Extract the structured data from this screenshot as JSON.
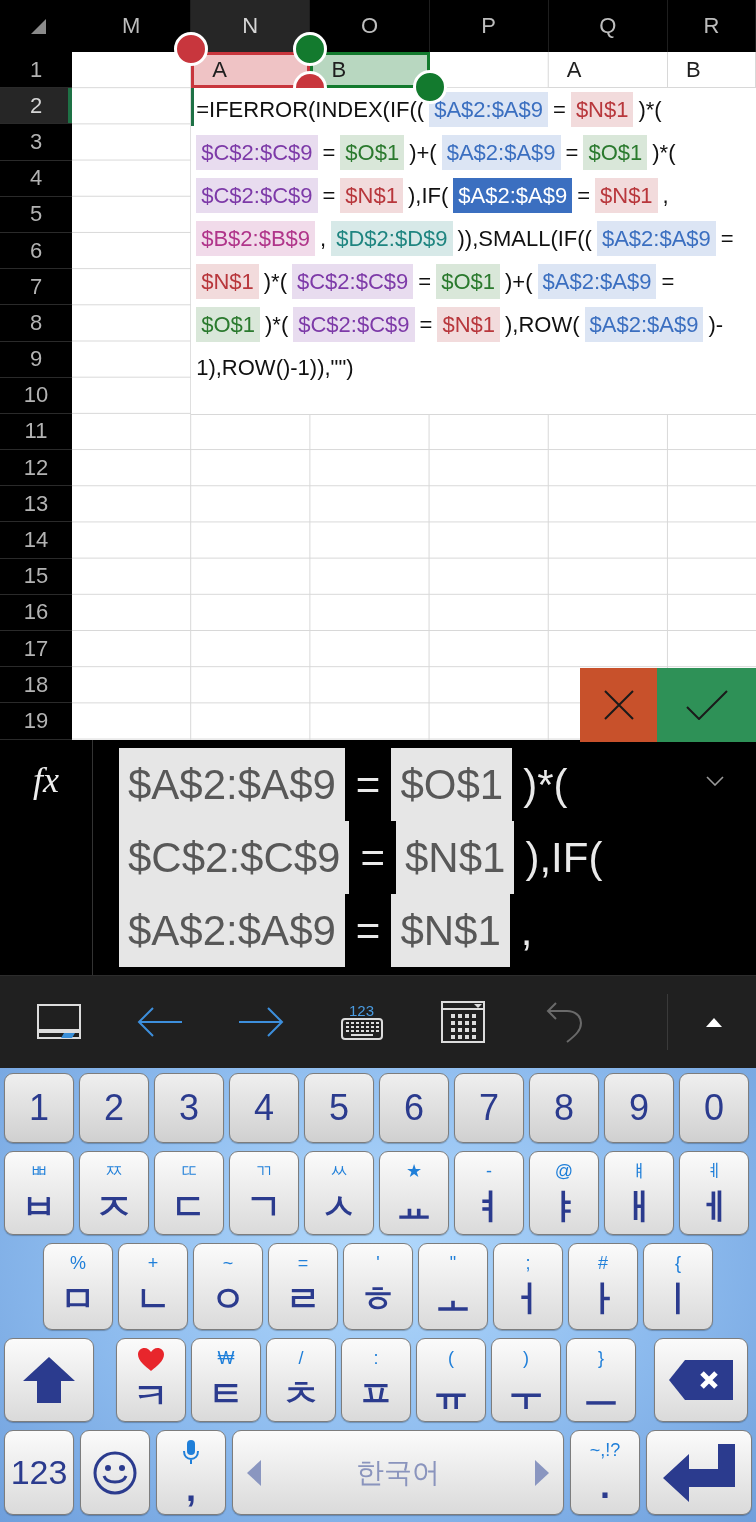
{
  "grid": {
    "columns": [
      {
        "label": "M",
        "selected": false
      },
      {
        "label": "N",
        "selected": true
      },
      {
        "label": "O",
        "selected": false
      },
      {
        "label": "P",
        "selected": false
      },
      {
        "label": "Q",
        "selected": false
      },
      {
        "label": "R",
        "selected": false
      }
    ],
    "rows": [
      {
        "label": "1",
        "selected": false,
        "cells": [
          null,
          {
            "text": "A",
            "color": "#c8363d"
          },
          {
            "text": "B",
            "color": "#137a2e"
          },
          null,
          {
            "text": "A"
          },
          {
            "text": "B"
          }
        ]
      },
      {
        "label": "2",
        "selected": true
      },
      {
        "label": "3",
        "selected": false
      },
      {
        "label": "4",
        "selected": false
      },
      {
        "label": "5",
        "selected": false
      },
      {
        "label": "6",
        "selected": false
      },
      {
        "label": "7",
        "selected": false
      },
      {
        "label": "8",
        "selected": false
      },
      {
        "label": "9",
        "selected": false
      },
      {
        "label": "10",
        "selected": false
      },
      {
        "label": "11",
        "selected": false
      },
      {
        "label": "12",
        "selected": false
      },
      {
        "label": "13",
        "selected": false
      },
      {
        "label": "14",
        "selected": false
      },
      {
        "label": "15",
        "selected": false
      },
      {
        "label": "16",
        "selected": false
      },
      {
        "label": "17",
        "selected": false
      },
      {
        "label": "18",
        "selected": false
      },
      {
        "label": "19",
        "selected": false
      }
    ]
  },
  "cell_editor": {
    "lines": [
      [
        {
          "kind": "text",
          "text": "=IFERROR(INDEX(IF(("
        },
        {
          "kind": "ref",
          "text": "$A$2:$A$9",
          "color": "#3b6fc0",
          "selected": false
        },
        {
          "kind": "text",
          "text": "="
        },
        {
          "kind": "ref",
          "text": "$N$1",
          "color": "#b8373c",
          "selected": false
        },
        {
          "kind": "text",
          "text": ")*("
        }
      ],
      [
        {
          "kind": "ref",
          "text": "$C$2:$C$9",
          "color": "#7d3aa8",
          "selected": false
        },
        {
          "kind": "text",
          "text": "="
        },
        {
          "kind": "ref",
          "text": "$O$1",
          "color": "#2b7a2e",
          "selected": false
        },
        {
          "kind": "text",
          "text": ")+("
        },
        {
          "kind": "ref",
          "text": "$A$2:$A$9",
          "color": "#3b6fc0",
          "selected": false
        },
        {
          "kind": "text",
          "text": "="
        },
        {
          "kind": "ref",
          "text": "$O$1",
          "color": "#2b7a2e",
          "selected": false
        },
        {
          "kind": "text",
          "text": ")*("
        }
      ],
      [
        {
          "kind": "ref",
          "text": "$C$2:$C$9",
          "color": "#7d3aa8",
          "selected": false
        },
        {
          "kind": "text",
          "text": "="
        },
        {
          "kind": "ref",
          "text": "$N$1",
          "color": "#b8373c",
          "selected": false
        },
        {
          "kind": "text",
          "text": "),IF("
        },
        {
          "kind": "ref",
          "text": "$A$2:$A$9",
          "color": "#3b6fc0",
          "selected": true
        },
        {
          "kind": "text",
          "text": "="
        },
        {
          "kind": "ref",
          "text": "$N$1",
          "color": "#b8373c",
          "selected": false
        },
        {
          "kind": "text",
          "text": ","
        }
      ],
      [
        {
          "kind": "ref",
          "text": "$B$2:$B$9",
          "color": "#b0358a",
          "selected": false
        },
        {
          "kind": "text",
          "text": ","
        },
        {
          "kind": "ref",
          "text": "$D$2:$D$9",
          "color": "#1f8580",
          "selected": false
        },
        {
          "kind": "text",
          "text": ")),SMALL(IF(("
        },
        {
          "kind": "ref",
          "text": "$A$2:$A$9",
          "color": "#3b6fc0",
          "selected": false
        },
        {
          "kind": "text",
          "text": "="
        }
      ],
      [
        {
          "kind": "ref",
          "text": "$N$1",
          "color": "#b8373c",
          "selected": false
        },
        {
          "kind": "text",
          "text": ")*("
        },
        {
          "kind": "ref",
          "text": "$C$2:$C$9",
          "color": "#7d3aa8",
          "selected": false
        },
        {
          "kind": "text",
          "text": "="
        },
        {
          "kind": "ref",
          "text": "$O$1",
          "color": "#2b7a2e",
          "selected": false
        },
        {
          "kind": "text",
          "text": ")+("
        },
        {
          "kind": "ref",
          "text": "$A$2:$A$9",
          "color": "#3b6fc0",
          "selected": false
        },
        {
          "kind": "text",
          "text": "="
        }
      ],
      [
        {
          "kind": "ref",
          "text": "$O$1",
          "color": "#2b7a2e",
          "selected": false
        },
        {
          "kind": "text",
          "text": ")*("
        },
        {
          "kind": "ref",
          "text": "$C$2:$C$9",
          "color": "#7d3aa8",
          "selected": false
        },
        {
          "kind": "text",
          "text": "="
        },
        {
          "kind": "ref",
          "text": "$N$1",
          "color": "#b8373c",
          "selected": false
        },
        {
          "kind": "text",
          "text": "),ROW("
        },
        {
          "kind": "ref",
          "text": "$A$2:$A$9",
          "color": "#3b6fc0",
          "selected": false
        },
        {
          "kind": "text",
          "text": ")-"
        }
      ],
      [
        {
          "kind": "text",
          "text": "1),ROW()-1)),\"\")"
        }
      ]
    ]
  },
  "formula_bar": {
    "label": "fx",
    "lines": [
      [
        {
          "kind": "ref",
          "text": "$A$2:$A$9"
        },
        {
          "kind": "text",
          "text": "="
        },
        {
          "kind": "ref",
          "text": "$O$1"
        },
        {
          "kind": "text",
          "text": ")*("
        }
      ],
      [
        {
          "kind": "ref",
          "text": "$C$2:$C$9"
        },
        {
          "kind": "text",
          "text": "="
        },
        {
          "kind": "ref",
          "text": "$N$1"
        },
        {
          "kind": "text",
          "text": "),IF("
        }
      ],
      [
        {
          "kind": "ref",
          "text": "$A$2:$A$9"
        },
        {
          "kind": "text",
          "text": "="
        },
        {
          "kind": "ref",
          "text": "$N$1"
        },
        {
          "kind": "text",
          "text": ","
        }
      ]
    ]
  },
  "toolbar": [
    {
      "kind": "display",
      "disabled": false
    },
    {
      "kind": "back",
      "disabled": false
    },
    {
      "kind": "forward",
      "disabled": false
    },
    {
      "kind": "numpad",
      "label": "123",
      "disabled": false
    },
    {
      "kind": "grid",
      "disabled": false
    },
    {
      "kind": "undo",
      "disabled": true
    },
    {
      "kind": "collapse",
      "disabled": false
    }
  ],
  "keyboard": {
    "rows": [
      [
        {
          "kind": "char",
          "label": "1"
        },
        {
          "kind": "char",
          "label": "2"
        },
        {
          "kind": "char",
          "label": "3"
        },
        {
          "kind": "char",
          "label": "4"
        },
        {
          "kind": "char",
          "label": "5"
        },
        {
          "kind": "char",
          "label": "6"
        },
        {
          "kind": "char",
          "label": "7"
        },
        {
          "kind": "char",
          "label": "8"
        },
        {
          "kind": "char",
          "label": "9"
        },
        {
          "kind": "char",
          "label": "0"
        }
      ],
      [
        {
          "kind": "char",
          "label": "ㅂ",
          "hint": "ㅃ"
        },
        {
          "kind": "char",
          "label": "ㅈ",
          "hint": "ㅉ"
        },
        {
          "kind": "char",
          "label": "ㄷ",
          "hint": "ㄸ"
        },
        {
          "kind": "char",
          "label": "ㄱ",
          "hint": "ㄲ"
        },
        {
          "kind": "char",
          "label": "ㅅ",
          "hint": "ㅆ"
        },
        {
          "kind": "char",
          "label": "ㅛ",
          "hint": "★"
        },
        {
          "kind": "char",
          "label": "ㅕ",
          "hint": "-"
        },
        {
          "kind": "char",
          "label": "ㅑ",
          "hint": "@"
        },
        {
          "kind": "char",
          "label": "ㅐ",
          "hint": "ㅒ"
        },
        {
          "kind": "char",
          "label": "ㅔ",
          "hint": "ㅖ"
        }
      ],
      [
        {
          "kind": "char",
          "label": "ㅁ",
          "hint": "%"
        },
        {
          "kind": "char",
          "label": "ㄴ",
          "hint": "+"
        },
        {
          "kind": "char",
          "label": "ㅇ",
          "hint": "~"
        },
        {
          "kind": "char",
          "label": "ㄹ",
          "hint": "="
        },
        {
          "kind": "char",
          "label": "ㅎ",
          "hint": "'"
        },
        {
          "kind": "char",
          "label": "ㅗ",
          "hint": "\""
        },
        {
          "kind": "char",
          "label": "ㅓ",
          "hint": ";"
        },
        {
          "kind": "char",
          "label": "ㅏ",
          "hint": "#"
        },
        {
          "kind": "char",
          "label": "ㅣ",
          "hint": "{"
        }
      ],
      [
        {
          "kind": "shift"
        },
        {
          "kind": "heart",
          "label": "ㅋ"
        },
        {
          "kind": "char",
          "label": "ㅌ",
          "hint": "₩"
        },
        {
          "kind": "char",
          "label": "ㅊ",
          "hint": "/"
        },
        {
          "kind": "char",
          "label": "ㅍ",
          "hint": ":"
        },
        {
          "kind": "char",
          "label": "ㅠ",
          "hint": "("
        },
        {
          "kind": "char",
          "label": "ㅜ",
          "hint": ")"
        },
        {
          "kind": "char",
          "label": "ㅡ",
          "hint": "}"
        },
        {
          "kind": "backspace"
        }
      ],
      [
        {
          "kind": "mode",
          "label": "123"
        },
        {
          "kind": "emoji"
        },
        {
          "kind": "voice",
          "label": ","
        },
        {
          "kind": "space",
          "label": "한국어"
        },
        {
          "kind": "char",
          "label": ".",
          "hint": "~,!?"
        },
        {
          "kind": "enter"
        }
      ]
    ]
  }
}
